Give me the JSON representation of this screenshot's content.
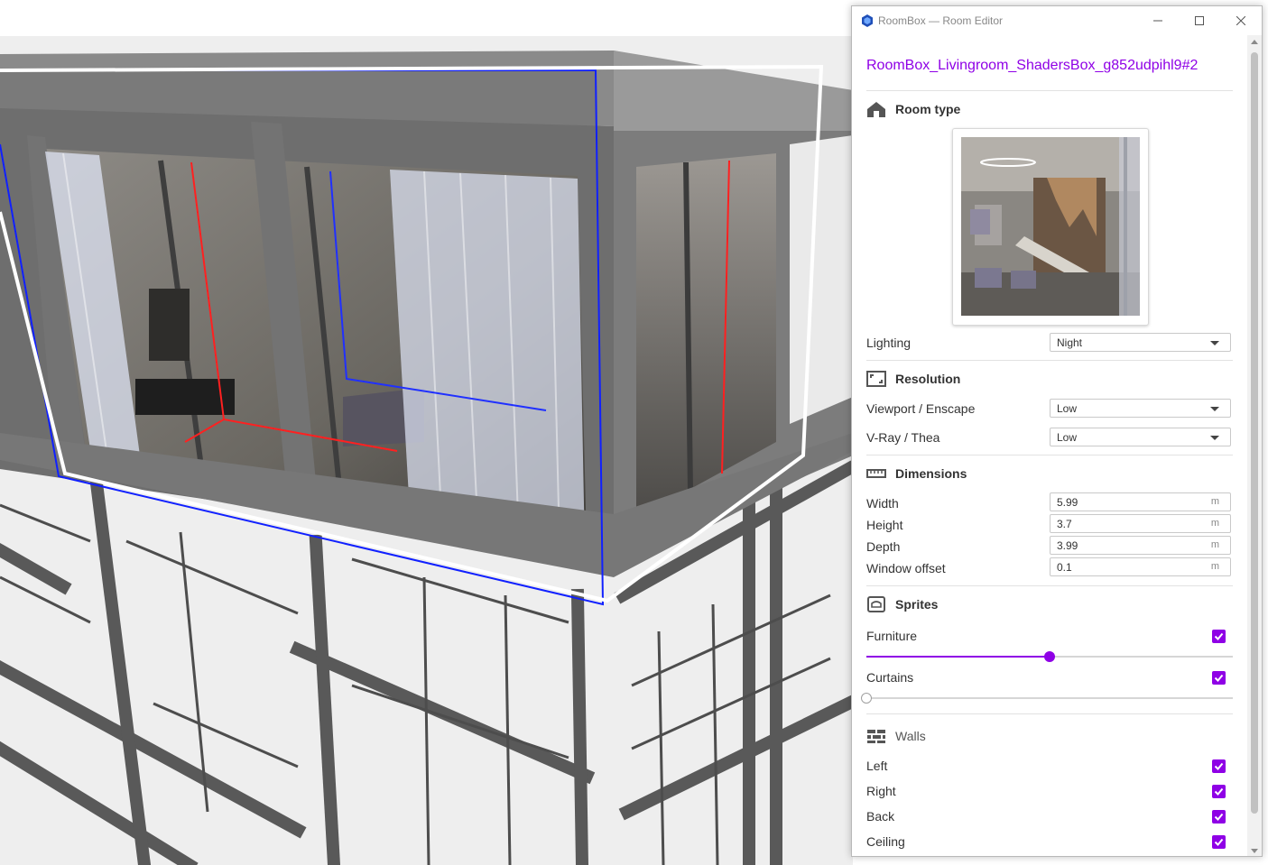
{
  "window": {
    "title": "RoomBox — Room Editor",
    "accent_color": "#8f00e6"
  },
  "room_name": "RoomBox_Livingroom_ShadersBox_g852udpihl9#2",
  "room_type": {
    "title": "Room type",
    "icon": "house-icon",
    "preview_icon": "room-preview-image"
  },
  "lighting": {
    "label": "Lighting",
    "value": "Night"
  },
  "resolution": {
    "title": "Resolution",
    "icon": "resolution-icon",
    "viewport": {
      "label": "Viewport / Enscape",
      "value": "Low"
    },
    "vray": {
      "label": "V-Ray / Thea",
      "value": "Low"
    }
  },
  "dimensions": {
    "title": "Dimensions",
    "icon": "ruler-icon",
    "unit": "m",
    "fields": [
      {
        "label": "Width",
        "value": "5.99"
      },
      {
        "label": "Height",
        "value": "3.7"
      },
      {
        "label": "Depth",
        "value": "3.99"
      },
      {
        "label": "Window offset",
        "value": "0.1"
      }
    ]
  },
  "sprites": {
    "title": "Sprites",
    "icon": "sprites-icon",
    "furniture": {
      "label": "Furniture",
      "checked": true,
      "level": 0.5
    },
    "curtains": {
      "label": "Curtains",
      "checked": true,
      "level": 0.0
    }
  },
  "walls": {
    "title": "Walls",
    "icon": "walls-icon",
    "items": [
      {
        "label": "Left",
        "checked": true
      },
      {
        "label": "Right",
        "checked": true
      },
      {
        "label": "Back",
        "checked": true
      },
      {
        "label": "Ceiling",
        "checked": true
      }
    ]
  }
}
